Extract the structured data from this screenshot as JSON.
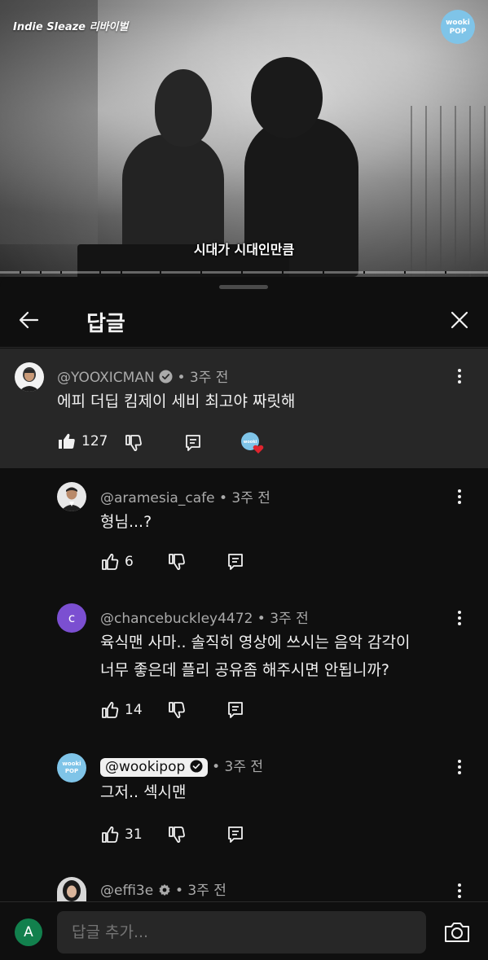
{
  "video": {
    "title": "Indie Sleaze 리바이벌",
    "logo_line1": "wooki",
    "logo_line2": "POP",
    "subtitle": "시대가 시대인만큼"
  },
  "sheet": {
    "title": "답글"
  },
  "parent_comment": {
    "author": "@YOOXICMAN",
    "verified": true,
    "time": "• 3주 전",
    "text": "에피 더딥 킴제이 세비 최고야 짜릿해",
    "likes": "127"
  },
  "replies": [
    {
      "author": "@aramesia_cafe",
      "time": "• 3주 전",
      "lines": [
        "형님...?"
      ],
      "likes": "6"
    },
    {
      "author": "@chancebuckley4472",
      "avatar_letter": "c",
      "avatar_color": "#7b4fd1",
      "time": "• 3주 전",
      "lines": [
        "육식맨 사마.. 솔직히 영상에 쓰시는 음악 감각이",
        "너무 좋은데 플리 공유좀 해주시면 안됩니까?"
      ],
      "likes": "14"
    },
    {
      "author": "@wookipop",
      "creator": true,
      "time": "• 3주 전",
      "lines": [
        "그저.. 섹시맨"
      ],
      "likes": "31"
    },
    {
      "author": "@effi3e",
      "time": "• 3주 전"
    }
  ],
  "bottom_bar": {
    "avatar_letter": "A",
    "input_placeholder": "답글 추가..."
  },
  "colors": {
    "background": "#0f0f0f",
    "highlight_row": "#272727",
    "secondary_text": "#aaaaaa",
    "heart": "#e0242e",
    "wookipop_blue": "#7fc4e8"
  }
}
